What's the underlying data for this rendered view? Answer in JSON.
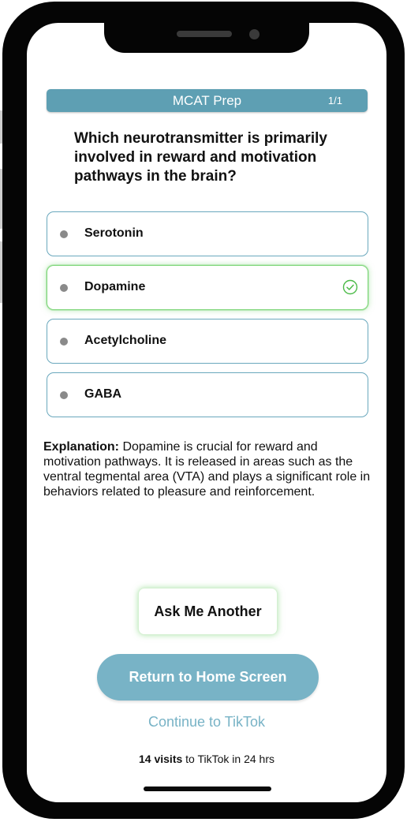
{
  "header": {
    "title": "MCAT Prep",
    "counter": "1/1"
  },
  "question": "Which neurotransmitter is primarily involved in reward and motivation pathways in the brain?",
  "options": [
    {
      "label": "Serotonin",
      "correct": false
    },
    {
      "label": "Dopamine",
      "correct": true
    },
    {
      "label": "Acetylcholine",
      "correct": false
    },
    {
      "label": "GABA",
      "correct": false
    }
  ],
  "explanation": {
    "label": "Explanation:",
    "text": "Dopamine is crucial for reward and motivation pathways. It is released in areas such as the ventral tegmental area (VTA) and plays a significant role in behaviors related to pleasure and reinforcement."
  },
  "buttons": {
    "ask_another": "Ask Me Another",
    "return_home": "Return to Home Screen",
    "continue": "Continue to TikTok"
  },
  "footer": {
    "visits_count": "14 visits",
    "visits_suffix": "to TikTok in 24 hrs"
  },
  "icons": {
    "correct": "check-circle-icon"
  },
  "colors": {
    "accent": "#5e9fb3",
    "button": "#78b3c6",
    "correct": "#7fd67a",
    "bullet": "#8a8a8a"
  }
}
